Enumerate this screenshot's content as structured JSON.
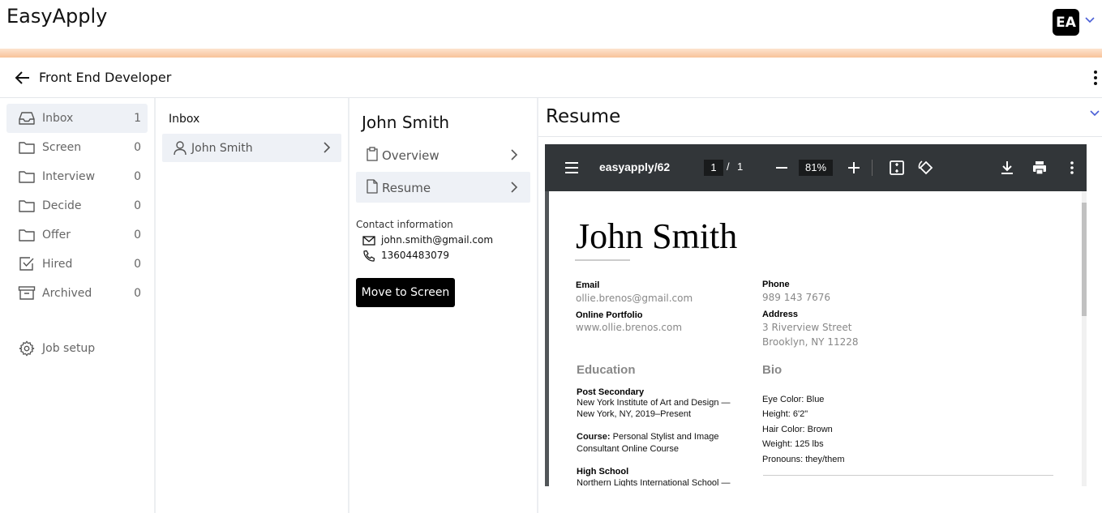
{
  "app": {
    "brand": "EasyApply",
    "avatar_initials": "EA"
  },
  "job": {
    "title": "Front End Developer"
  },
  "sidebar": {
    "items": [
      {
        "label": "Inbox",
        "count": "1",
        "icon": "inbox-icon"
      },
      {
        "label": "Screen",
        "count": "0",
        "icon": "folder-icon"
      },
      {
        "label": "Interview",
        "count": "0",
        "icon": "folder-icon"
      },
      {
        "label": "Decide",
        "count": "0",
        "icon": "folder-icon"
      },
      {
        "label": "Offer",
        "count": "0",
        "icon": "folder-icon"
      },
      {
        "label": "Hired",
        "count": "0",
        "icon": "checkbox-icon"
      },
      {
        "label": "Archived",
        "count": "0",
        "icon": "archive-icon"
      }
    ],
    "job_setup": "Job setup"
  },
  "list": {
    "heading": "Inbox",
    "candidates": [
      {
        "name": "John Smith"
      }
    ]
  },
  "candidate": {
    "name": "John Smith",
    "tabs": [
      {
        "label": "Overview"
      },
      {
        "label": "Resume"
      }
    ],
    "contact_heading": "Contact information",
    "email": "john.smith@gmail.com",
    "phone": "13604483079",
    "move_button": "Move to Screen"
  },
  "resume_panel": {
    "title": "Resume",
    "viewer": {
      "doc_title": "easyapply/62",
      "page_current": "1",
      "page_sep": "/",
      "page_total": "1",
      "zoom": "81%",
      "scroll_position": 0.0
    },
    "document": {
      "name": "John Smith",
      "email_label": "Email",
      "email": "ollie.brenos@gmail.com",
      "portfolio_label": "Online Portfolio",
      "portfolio": "www.ollie.brenos.com",
      "phone_label": "Phone",
      "phone": "989 143 7676",
      "address_label": "Address",
      "address_line1": "3 Riverview Street",
      "address_line2": "Brooklyn, NY 11228",
      "education_heading": "Education",
      "post_secondary_label": "Post Secondary",
      "post_secondary_line1": "New York Institute of Art and Design —",
      "post_secondary_line2": "New York, NY, 2019–Present",
      "course_label": "Course:",
      "course_line1": " Personal Stylist and Image",
      "course_line2": "Consultant Online Course",
      "high_school_label": "High School",
      "high_school_line1": "Northern Lights International School —",
      "bio_heading": "Bio",
      "bio": [
        "Eye Color: Blue",
        "Height: 6'2\"",
        "Hair Color: Brown",
        "Weight: 125 lbs",
        "Pronouns: they/them"
      ]
    }
  },
  "colors": {
    "active_bg": "#eef1f6",
    "accent_chevron": "#4a5fd6",
    "pdf_toolbar": "#323639",
    "pdf_bg": "#525659"
  }
}
